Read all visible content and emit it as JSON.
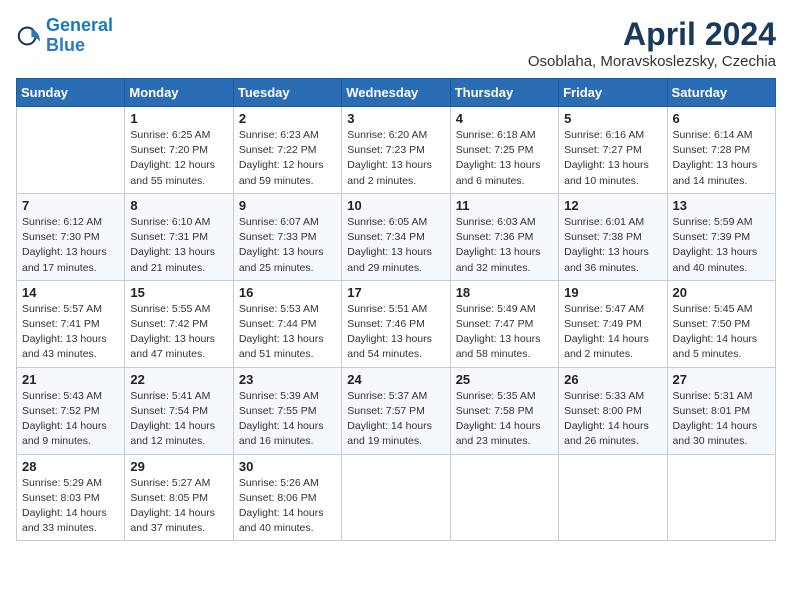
{
  "header": {
    "logo_line1": "General",
    "logo_line2": "Blue",
    "month": "April 2024",
    "location": "Osoblaha, Moravskoslezsky, Czechia"
  },
  "weekdays": [
    "Sunday",
    "Monday",
    "Tuesday",
    "Wednesday",
    "Thursday",
    "Friday",
    "Saturday"
  ],
  "weeks": [
    [
      {
        "day": "",
        "info": ""
      },
      {
        "day": "1",
        "info": "Sunrise: 6:25 AM\nSunset: 7:20 PM\nDaylight: 12 hours\nand 55 minutes."
      },
      {
        "day": "2",
        "info": "Sunrise: 6:23 AM\nSunset: 7:22 PM\nDaylight: 12 hours\nand 59 minutes."
      },
      {
        "day": "3",
        "info": "Sunrise: 6:20 AM\nSunset: 7:23 PM\nDaylight: 13 hours\nand 2 minutes."
      },
      {
        "day": "4",
        "info": "Sunrise: 6:18 AM\nSunset: 7:25 PM\nDaylight: 13 hours\nand 6 minutes."
      },
      {
        "day": "5",
        "info": "Sunrise: 6:16 AM\nSunset: 7:27 PM\nDaylight: 13 hours\nand 10 minutes."
      },
      {
        "day": "6",
        "info": "Sunrise: 6:14 AM\nSunset: 7:28 PM\nDaylight: 13 hours\nand 14 minutes."
      }
    ],
    [
      {
        "day": "7",
        "info": "Sunrise: 6:12 AM\nSunset: 7:30 PM\nDaylight: 13 hours\nand 17 minutes."
      },
      {
        "day": "8",
        "info": "Sunrise: 6:10 AM\nSunset: 7:31 PM\nDaylight: 13 hours\nand 21 minutes."
      },
      {
        "day": "9",
        "info": "Sunrise: 6:07 AM\nSunset: 7:33 PM\nDaylight: 13 hours\nand 25 minutes."
      },
      {
        "day": "10",
        "info": "Sunrise: 6:05 AM\nSunset: 7:34 PM\nDaylight: 13 hours\nand 29 minutes."
      },
      {
        "day": "11",
        "info": "Sunrise: 6:03 AM\nSunset: 7:36 PM\nDaylight: 13 hours\nand 32 minutes."
      },
      {
        "day": "12",
        "info": "Sunrise: 6:01 AM\nSunset: 7:38 PM\nDaylight: 13 hours\nand 36 minutes."
      },
      {
        "day": "13",
        "info": "Sunrise: 5:59 AM\nSunset: 7:39 PM\nDaylight: 13 hours\nand 40 minutes."
      }
    ],
    [
      {
        "day": "14",
        "info": "Sunrise: 5:57 AM\nSunset: 7:41 PM\nDaylight: 13 hours\nand 43 minutes."
      },
      {
        "day": "15",
        "info": "Sunrise: 5:55 AM\nSunset: 7:42 PM\nDaylight: 13 hours\nand 47 minutes."
      },
      {
        "day": "16",
        "info": "Sunrise: 5:53 AM\nSunset: 7:44 PM\nDaylight: 13 hours\nand 51 minutes."
      },
      {
        "day": "17",
        "info": "Sunrise: 5:51 AM\nSunset: 7:46 PM\nDaylight: 13 hours\nand 54 minutes."
      },
      {
        "day": "18",
        "info": "Sunrise: 5:49 AM\nSunset: 7:47 PM\nDaylight: 13 hours\nand 58 minutes."
      },
      {
        "day": "19",
        "info": "Sunrise: 5:47 AM\nSunset: 7:49 PM\nDaylight: 14 hours\nand 2 minutes."
      },
      {
        "day": "20",
        "info": "Sunrise: 5:45 AM\nSunset: 7:50 PM\nDaylight: 14 hours\nand 5 minutes."
      }
    ],
    [
      {
        "day": "21",
        "info": "Sunrise: 5:43 AM\nSunset: 7:52 PM\nDaylight: 14 hours\nand 9 minutes."
      },
      {
        "day": "22",
        "info": "Sunrise: 5:41 AM\nSunset: 7:54 PM\nDaylight: 14 hours\nand 12 minutes."
      },
      {
        "day": "23",
        "info": "Sunrise: 5:39 AM\nSunset: 7:55 PM\nDaylight: 14 hours\nand 16 minutes."
      },
      {
        "day": "24",
        "info": "Sunrise: 5:37 AM\nSunset: 7:57 PM\nDaylight: 14 hours\nand 19 minutes."
      },
      {
        "day": "25",
        "info": "Sunrise: 5:35 AM\nSunset: 7:58 PM\nDaylight: 14 hours\nand 23 minutes."
      },
      {
        "day": "26",
        "info": "Sunrise: 5:33 AM\nSunset: 8:00 PM\nDaylight: 14 hours\nand 26 minutes."
      },
      {
        "day": "27",
        "info": "Sunrise: 5:31 AM\nSunset: 8:01 PM\nDaylight: 14 hours\nand 30 minutes."
      }
    ],
    [
      {
        "day": "28",
        "info": "Sunrise: 5:29 AM\nSunset: 8:03 PM\nDaylight: 14 hours\nand 33 minutes."
      },
      {
        "day": "29",
        "info": "Sunrise: 5:27 AM\nSunset: 8:05 PM\nDaylight: 14 hours\nand 37 minutes."
      },
      {
        "day": "30",
        "info": "Sunrise: 5:26 AM\nSunset: 8:06 PM\nDaylight: 14 hours\nand 40 minutes."
      },
      {
        "day": "",
        "info": ""
      },
      {
        "day": "",
        "info": ""
      },
      {
        "day": "",
        "info": ""
      },
      {
        "day": "",
        "info": ""
      }
    ]
  ]
}
